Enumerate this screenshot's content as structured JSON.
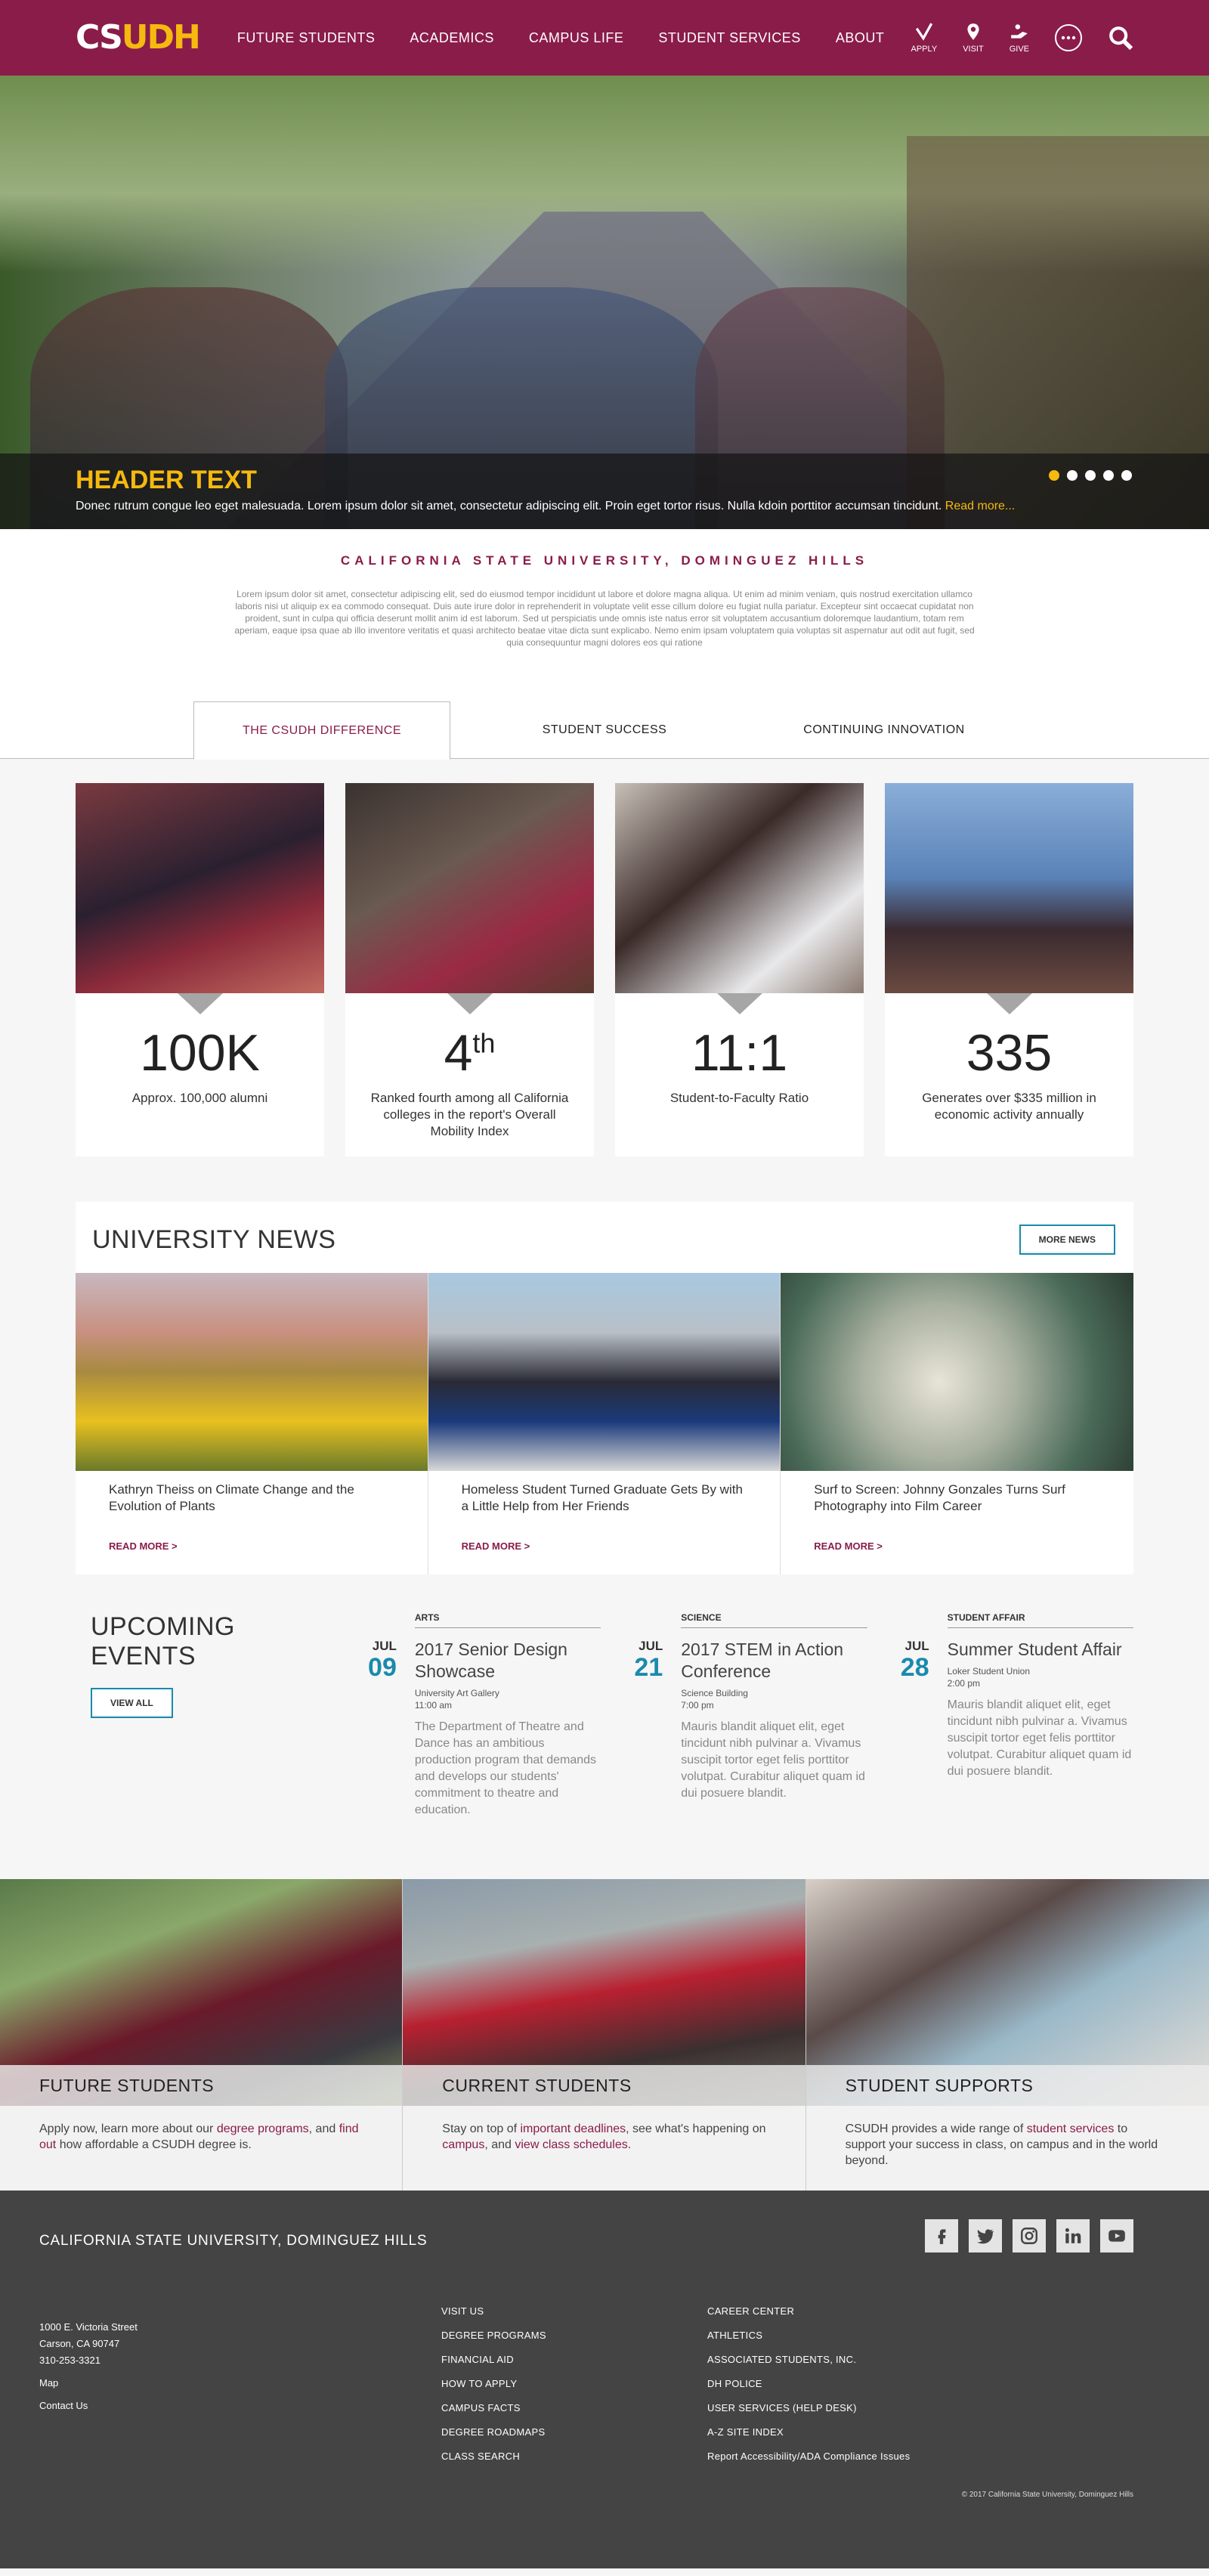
{
  "nav": {
    "logo_cs": "CS",
    "logo_dh": "UDH",
    "links": [
      "FUTURE STUDENTS",
      "ACADEMICS",
      "CAMPUS LIFE",
      "STUDENT SERVICES",
      "ABOUT"
    ],
    "apply": "APPLY",
    "visit": "VISIT",
    "give": "GIVE"
  },
  "hero": {
    "title": "HEADER TEXT",
    "text": "Donec rutrum congue leo eget malesuada. Lorem ipsum dolor sit amet, consectetur adipiscing elit. Proin eget tortor risus. Nulla kdoin porttitor accumsan tincidunt.",
    "read_more": "Read more...",
    "active_slide": 1,
    "slides": 5
  },
  "intro": {
    "title": "CALIFORNIA STATE UNIVERSITY, DOMINGUEZ HILLS",
    "body": "Lorem ipsum dolor sit amet, consectetur adipiscing elit, sed do eiusmod tempor incididunt ut labore et dolore magna aliqua. Ut enim ad minim veniam, quis nostrud exercitation ullamco laboris nisi ut aliquip ex ea commodo consequat. Duis aute irure dolor in reprehenderit in voluptate velit esse cillum dolore eu fugiat nulla pariatur. Excepteur sint occaecat cupidatat non proident, sunt in culpa qui officia deserunt mollit anim id est laborum. Sed ut perspiciatis unde omnis iste natus error sit voluptatem accusantium doloremque laudantium, totam rem aperiam, eaque ipsa quae ab illo inventore veritatis et quasi architecto beatae vitae dicta sunt explicabo. Nemo enim ipsam voluptatem quia voluptas sit aspernatur aut odit aut fugit, sed quia consequuntur magni dolores eos qui ratione"
  },
  "tabs": [
    "THE CSUDH DIFFERENCE",
    "STUDENT SUCCESS",
    "CONTINUING INNOVATION"
  ],
  "stats": [
    {
      "num": "100K",
      "sup": "",
      "desc": "Approx. 100,000 alumni"
    },
    {
      "num": "4",
      "sup": "th",
      "desc": "Ranked fourth among all California colleges in the report's Overall Mobility Index"
    },
    {
      "num": "11:1",
      "sup": "",
      "desc": "Student-to-Faculty Ratio"
    },
    {
      "num": "335",
      "sup": "",
      "desc": "Generates over $335 million in economic activity annually"
    }
  ],
  "news": {
    "title": "UNIVERSITY NEWS",
    "more": "MORE NEWS",
    "read_more": "READ MORE >",
    "items": [
      "Kathryn Theiss on Climate Change and the Evolution of Plants",
      "Homeless Student Turned Graduate Gets By with a Little Help from Her Friends",
      "Surf to Screen: Johnny Gonzales Turns Surf Photography into Film Career"
    ]
  },
  "events": {
    "title": "UPCOMING EVENTS",
    "view_all": "VIEW ALL",
    "items": [
      {
        "cat": "ARTS",
        "mon": "JUL",
        "day": "09",
        "title": "2017 Senior Design Showcase",
        "loc": "University Art Gallery",
        "time": "11:00 am",
        "desc": "The Department of Theatre and Dance has an ambitious production program that demands and develops our students' commitment to theatre and education."
      },
      {
        "cat": "SCIENCE",
        "mon": "JUL",
        "day": "21",
        "title": "2017 STEM in Action Conference",
        "loc": "Science Building",
        "time": "7:00 pm",
        "desc": "Mauris blandit aliquet elit, eget tincidunt nibh pulvinar a. Vivamus suscipit tortor eget felis porttitor volutpat. Curabitur aliquet quam id dui posuere blandit."
      },
      {
        "cat": "STUDENT AFFAIR",
        "mon": "JUL",
        "day": "28",
        "title": "Summer Student Affair",
        "loc": "Loker Student Union",
        "time": "2:00 pm",
        "desc": "Mauris blandit aliquet elit, eget tincidunt nibh pulvinar a. Vivamus suscipit tortor eget felis porttitor volutpat. Curabitur aliquet quam id dui posuere blandit."
      }
    ]
  },
  "promo": [
    {
      "label": "FUTURE STUDENTS",
      "t1": "Apply now, learn more about our ",
      "l1": "degree programs",
      "t2": ", and ",
      "l2": "find out",
      "t3": " how affordable a CSUDH degree is.",
      "l3": "",
      "t4": ""
    },
    {
      "label": "CURRENT STUDENTS",
      "t1": "Stay on top of ",
      "l1": "important deadlines",
      "t2": ", see what's happening on ",
      "l2": "campus",
      "t3": ", and ",
      "l3": "view class schedules",
      "t4": "."
    },
    {
      "label": "STUDENT SUPPORTS",
      "t1": "CSUDH provides a wide range of ",
      "l1": "student services",
      "t2": " to support your success in class, on campus and in the world beyond.",
      "l2": "",
      "t3": "",
      "l3": "",
      "t4": ""
    }
  ],
  "footer": {
    "title": "CALIFORNIA STATE UNIVERSITY, DOMINGUEZ HILLS",
    "addr1": "1000 E. Victoria Street",
    "addr2": "Carson, CA 90747",
    "phone": "310-253-3321",
    "map": "Map",
    "contact": "Contact Us",
    "col1": [
      "VISIT US",
      "DEGREE PROGRAMS",
      "FINANCIAL AID",
      "HOW TO APPLY",
      "CAMPUS FACTS",
      "DEGREE ROADMAPS",
      "CLASS SEARCH"
    ],
    "col2": [
      "CAREER CENTER",
      "ATHLETICS",
      "ASSOCIATED STUDENTS, INC.",
      "DH POLICE",
      "USER SERVICES (HELP DESK)",
      "A-Z SITE INDEX",
      "Report Accessibility/ADA Compliance Issues"
    ],
    "copyright": "© 2017 California State University, Dominguez Hills"
  },
  "colors": {
    "brand": "#8a1c4a",
    "accent": "#f5b90f",
    "teal": "#1a8aad"
  }
}
